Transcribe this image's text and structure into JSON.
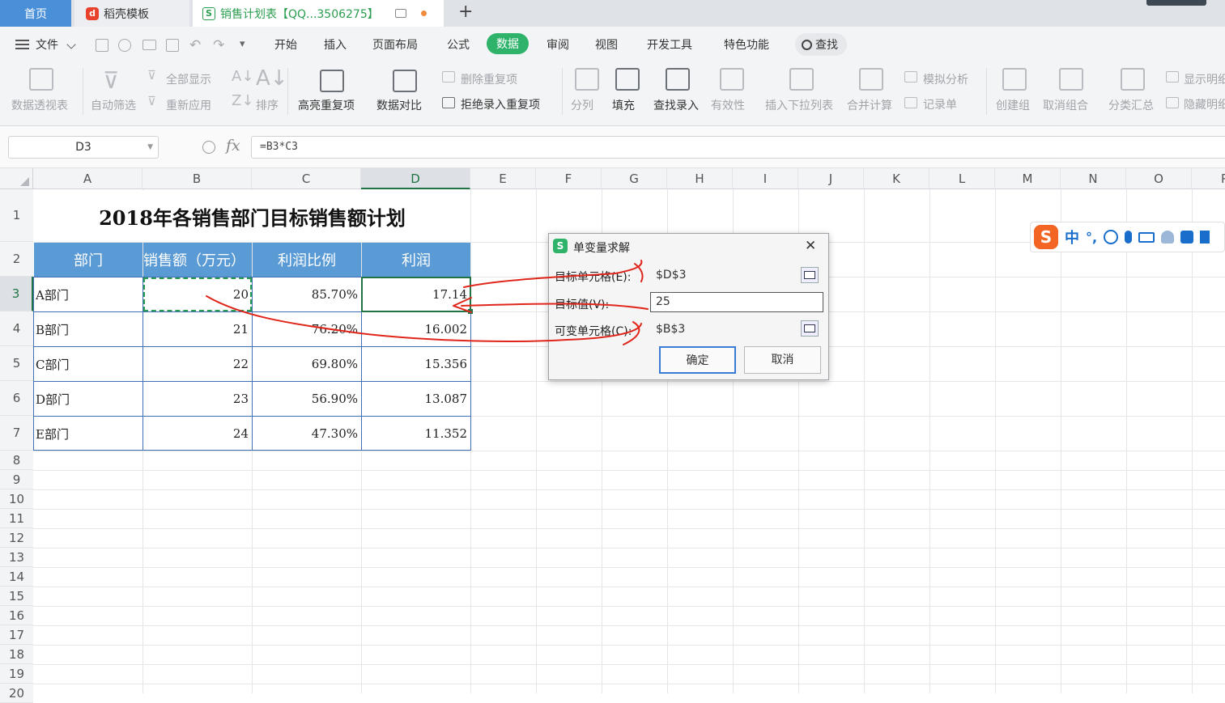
{
  "tabs": {
    "home": "首页",
    "template": "稻壳模板",
    "file": "销售计划表【QQ...3506275】",
    "new_tab": "+"
  },
  "menu": {
    "file": "文件",
    "items": [
      "开始",
      "插入",
      "页面布局",
      "公式",
      "数据",
      "审阅",
      "视图",
      "开发工具",
      "特色功能"
    ],
    "active": "数据",
    "search": "查找"
  },
  "ribbon": {
    "pivot": "数据透视表",
    "auto_filter": "自动筛选",
    "show_all": "全部显示",
    "reapply": "重新应用",
    "sort": "排序",
    "highlight_dup": "高亮重复项",
    "data_compare": "数据对比",
    "delete_dup": "删除重复项",
    "reject_dup": "拒绝录入重复项",
    "split": "分列",
    "fill": "填充",
    "lookup_entry": "查找录入",
    "validity": "有效性",
    "insert_dropdown": "插入下拉列表",
    "merge_calc": "合并计算",
    "what_if": "模拟分析",
    "record": "记录单",
    "create_group": "创建组",
    "ungroup": "取消组合",
    "subtotal": "分类汇总",
    "show_detail": "显示明细",
    "hide_detail": "隐藏明细"
  },
  "formula_bar": {
    "name_box": "D3",
    "fx": "fx",
    "formula": "=B3*C3"
  },
  "columns": [
    "A",
    "B",
    "C",
    "D",
    "E",
    "F",
    "G",
    "H",
    "I",
    "J",
    "K",
    "L",
    "M",
    "N",
    "O",
    "P"
  ],
  "rows": [
    "1",
    "2",
    "3",
    "4",
    "5",
    "6",
    "7",
    "8",
    "9",
    "10",
    "11",
    "12",
    "13",
    "14",
    "15",
    "16",
    "17",
    "18",
    "19",
    "20"
  ],
  "sheet": {
    "title": "2018年各销售部门目标销售额计划",
    "headers": [
      "部门",
      "销售额（万元）",
      "利润比例",
      "利润"
    ],
    "data": [
      [
        "A部门",
        "20",
        "85.70%",
        "17.14"
      ],
      [
        "B部门",
        "21",
        "76.20%",
        "16.002"
      ],
      [
        "C部门",
        "22",
        "69.80%",
        "15.356"
      ],
      [
        "D部门",
        "23",
        "56.90%",
        "13.087"
      ],
      [
        "E部门",
        "24",
        "47.30%",
        "11.352"
      ]
    ]
  },
  "dialog": {
    "title": "单变量求解",
    "target_cell_label": "目标单元格(E):",
    "target_cell_value": "$D$3",
    "target_value_label": "目标值(V):",
    "target_value": "25",
    "variable_cell_label": "可变单元格(C):",
    "variable_cell_value": "$B$3",
    "ok": "确定",
    "cancel": "取消",
    "close": "✕"
  },
  "ime": {
    "mode": "中",
    "punct": "°,"
  },
  "colors": {
    "accent_green": "#2fb36b",
    "header_blue": "#5b9bd5",
    "annotation_red": "#e0261b"
  }
}
